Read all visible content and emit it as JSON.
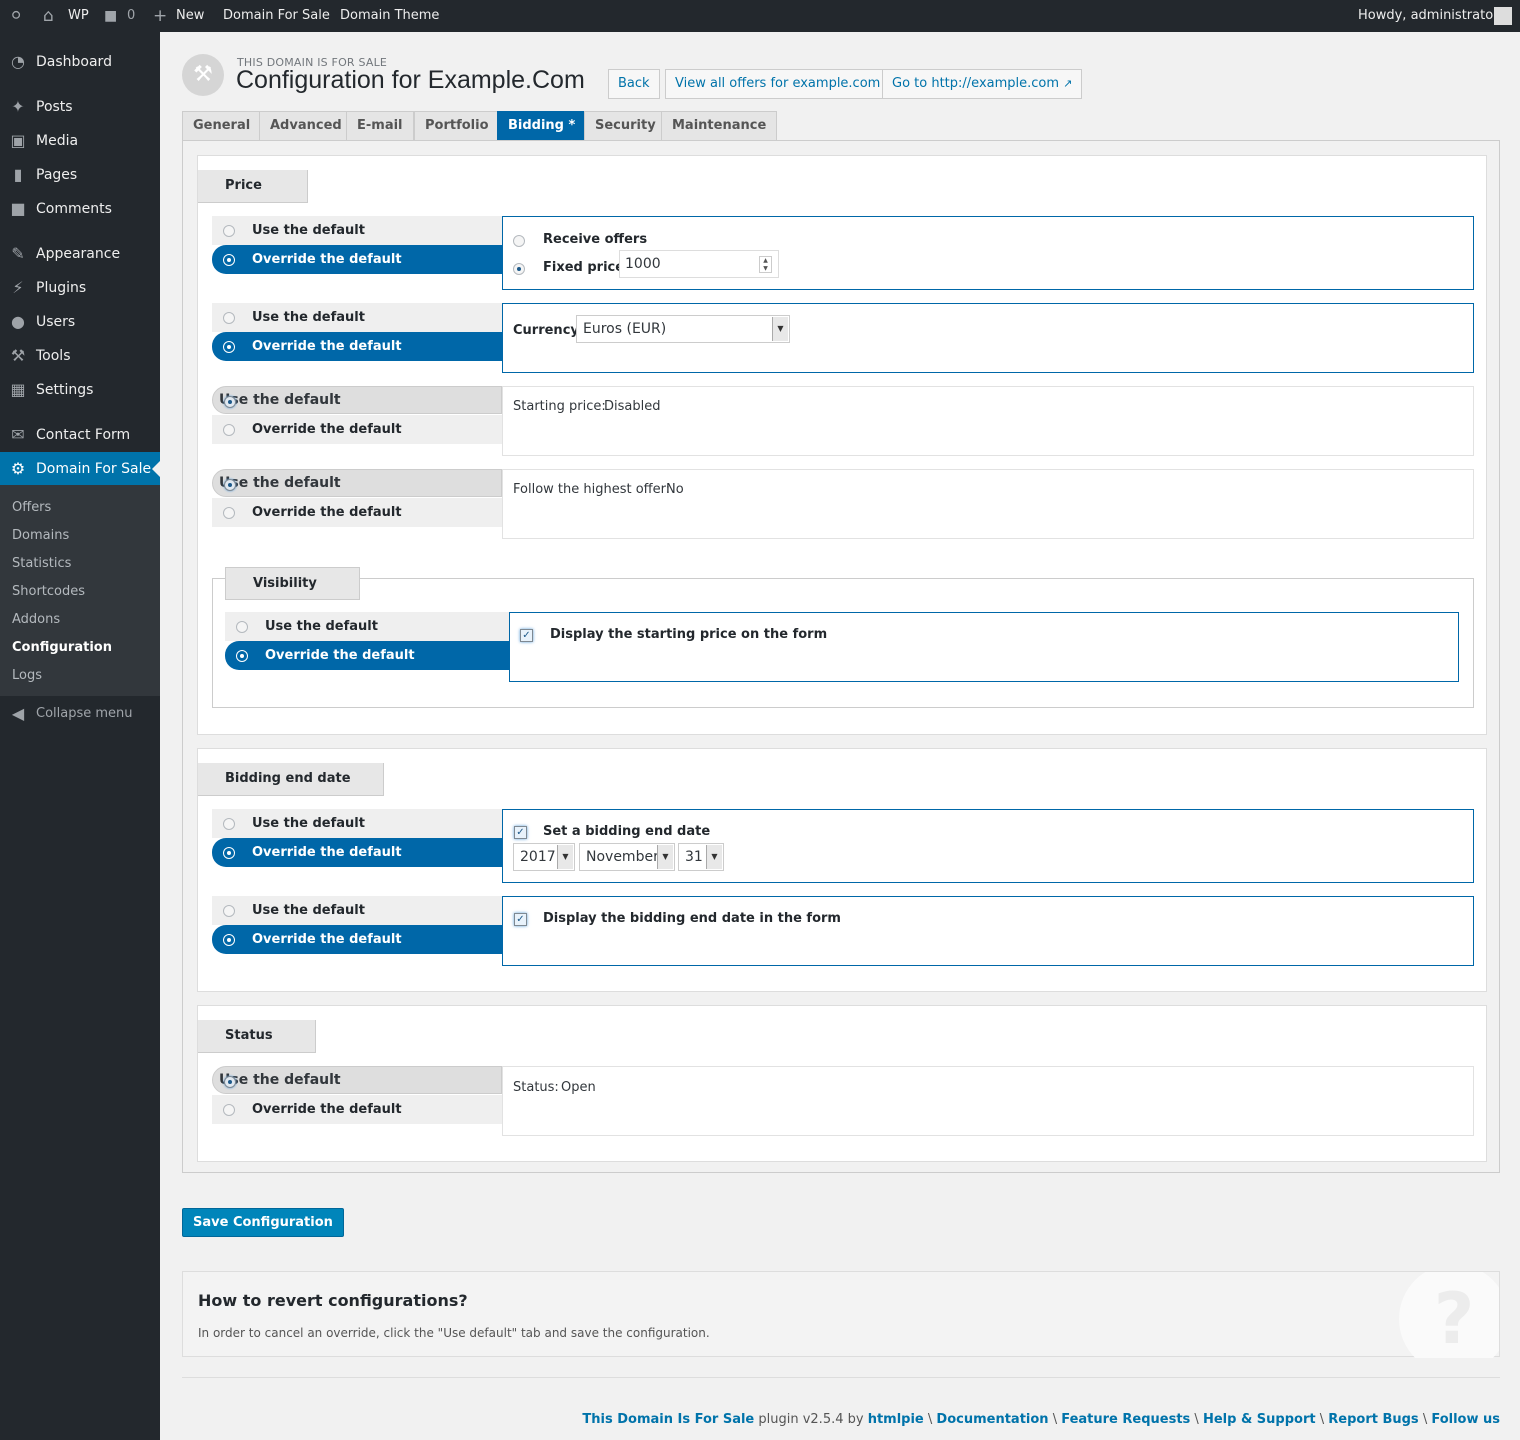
{
  "adminbar": {
    "site": "WP",
    "comments": "0",
    "new": "New",
    "link1": "Domain For Sale",
    "link2": "Domain Theme",
    "howdy": "Howdy, administrator"
  },
  "menu": [
    {
      "label": "Dashboard",
      "icon": "dashboard-icon"
    },
    {
      "label": "Posts",
      "icon": "pin-icon"
    },
    {
      "label": "Media",
      "icon": "media-icon"
    },
    {
      "label": "Pages",
      "icon": "pages-icon"
    },
    {
      "label": "Comments",
      "icon": "comment-icon"
    },
    {
      "label": "Appearance",
      "icon": "brush-icon"
    },
    {
      "label": "Plugins",
      "icon": "plug-icon"
    },
    {
      "label": "Users",
      "icon": "user-icon"
    },
    {
      "label": "Tools",
      "icon": "wrench-icon"
    },
    {
      "label": "Settings",
      "icon": "settings-icon"
    },
    {
      "label": "Contact Form",
      "icon": "mail-icon"
    },
    {
      "label": "Domain For Sale",
      "icon": "gear-icon"
    }
  ],
  "submenu": [
    "Offers",
    "Domains",
    "Statistics",
    "Shortcodes",
    "Addons",
    "Configuration",
    "Logs"
  ],
  "collapse": "Collapse menu",
  "header": {
    "supertitle": "THIS DOMAIN IS FOR SALE",
    "title": "Configuration for Example.Com",
    "back": "Back",
    "view_offers": "View all offers for example.com",
    "goto": "Go to http://example.com"
  },
  "tabs": [
    "General",
    "Advanced",
    "E-mail",
    "Portfolio",
    "Bidding *",
    "Security",
    "Maintenance"
  ],
  "opts": {
    "use": "Use the default",
    "over": "Override the default"
  },
  "price": {
    "legend": "Price",
    "receive": "Receive offers",
    "fixed_label": "Fixed price:",
    "fixed_value": "1000",
    "currency_label": "Currency:",
    "currency_value": "Euros (EUR)",
    "starting_label": "Starting price:",
    "starting_value": "Disabled",
    "follow_label": "Follow the highest offer:",
    "follow_value": "No"
  },
  "visibility": {
    "legend": "Visibility",
    "display_starting": "Display the starting price on the form"
  },
  "bidding": {
    "legend": "Bidding end date",
    "set_label": "Set a bidding end date",
    "year": "2017",
    "month": "November",
    "day": "31",
    "display_end": "Display the bidding end date in the form"
  },
  "status": {
    "legend": "Status",
    "label": "Status:",
    "value": "Open"
  },
  "save": "Save Configuration",
  "help": {
    "title": "How to revert configurations?",
    "text": "In order to cancel an override, click the \"Use default\" tab and save the configuration.",
    "icon": "?"
  },
  "footer": {
    "plugin": "This Domain Is For Sale",
    "mid": " plugin v2.5.4 by ",
    "author": "htmlpie",
    "sep": " \\ ",
    "doc": "Documentation",
    "feat": "Feature Requests",
    "help": "Help & Support",
    "bugs": "Report Bugs",
    "follow": "Follow us"
  }
}
